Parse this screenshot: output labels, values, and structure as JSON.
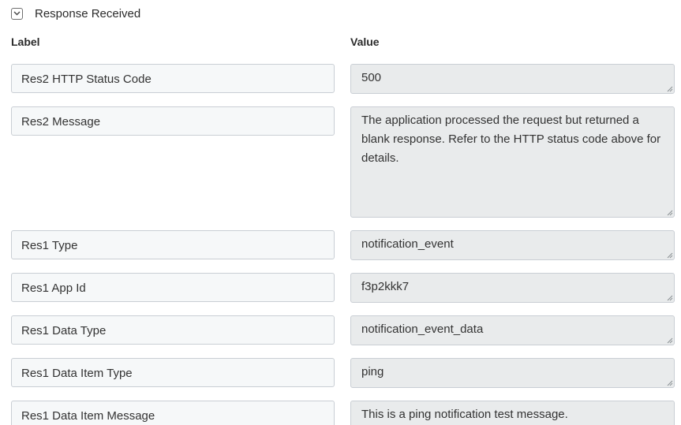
{
  "section": {
    "title": "Response Received",
    "toggle_icon": "chevron-down-icon"
  },
  "columns": {
    "label": "Label",
    "value": "Value"
  },
  "rows": [
    {
      "label": "Res2 HTTP Status Code",
      "value": "500"
    },
    {
      "label": "Res2 Message",
      "value": "The application processed the request but returned a blank response.  Refer to the HTTP status code above for details."
    },
    {
      "label": "Res1 Type",
      "value": "notification_event"
    },
    {
      "label": "Res1 App Id",
      "value": "f3p2kkk7"
    },
    {
      "label": "Res1 Data Type",
      "value": "notification_event_data"
    },
    {
      "label": "Res1 Data Item Type",
      "value": "ping"
    },
    {
      "label": "Res1 Data Item Message",
      "value": "This is a ping notification test message."
    }
  ],
  "colors": {
    "label_bg": "#f6f8f9",
    "value_bg": "#e9ebec",
    "border": "#c9ced4"
  }
}
